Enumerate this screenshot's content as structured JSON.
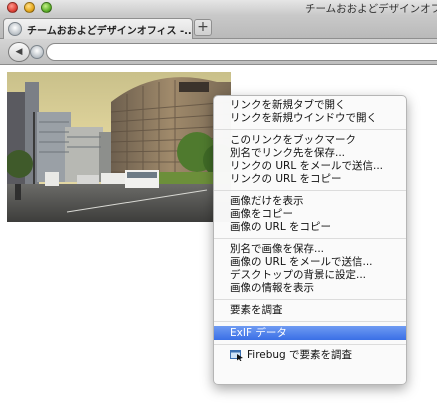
{
  "window": {
    "title": "チームおおよどデザインオフ"
  },
  "tabs": [
    {
      "title": "チームおおよどデザインオフィス -..."
    }
  ],
  "toolbar": {
    "new_tab_label": "+",
    "back_label": "◀",
    "url": ""
  },
  "context_menu": {
    "groups": [
      [
        "リンクを新規タブで開く",
        "リンクを新規ウインドウで開く"
      ],
      [
        "このリンクをブックマーク",
        "別名でリンク先を保存...",
        "リンクの URL をメールで送信...",
        "リンクの URL をコピー"
      ],
      [
        "画像だけを表示",
        "画像をコピー",
        "画像の URL をコピー"
      ],
      [
        "別名で画像を保存...",
        "画像の URL をメールで送信...",
        "デスクトップの背景に設定...",
        "画像の情報を表示"
      ],
      [
        "要素を調査"
      ],
      [
        "ExIF データ"
      ],
      [
        "Firebug で要素を調査"
      ]
    ],
    "highlighted": "ExIF データ"
  },
  "colors": {
    "highlight": "#3a6fe6",
    "titlebar": "#d6d6d6"
  }
}
